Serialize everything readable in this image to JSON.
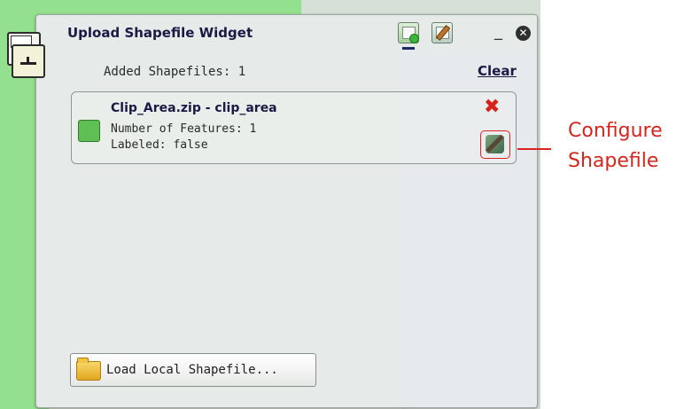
{
  "widget": {
    "title": "Upload Shapefile Widget",
    "header_icons": [
      "add-shapefile-icon",
      "edit-shapefile-icon"
    ],
    "minimize": "_",
    "close": "✕",
    "added_label": "Added Shapefiles: 1",
    "clear_label": "Clear",
    "shapefiles": [
      {
        "name": "Clip_Area.zip - clip_area",
        "features": "Number of Features: 1",
        "labeled": "Labeled: false",
        "color": "#5fbf55"
      }
    ],
    "load_button_label": "Load Local Shapefile..."
  },
  "callout": {
    "line1": "Configure",
    "line2": "Shapefile",
    "color": "#d4261c"
  }
}
